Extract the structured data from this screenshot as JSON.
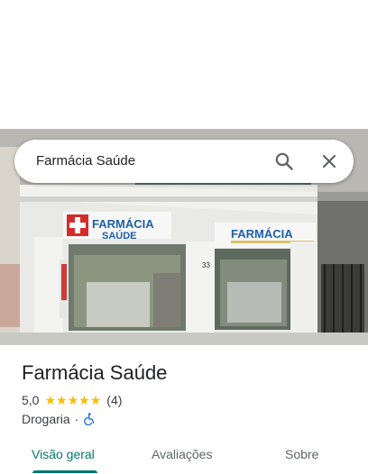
{
  "search": {
    "query": "Farmácia Saúde",
    "search_icon": "search-icon",
    "close_icon": "close-icon"
  },
  "photo": {
    "sign_left_line1": "FARMÁCIA",
    "sign_left_line2": "SAÚDE",
    "sign_right": "FARMÁCIA",
    "street_number": "33"
  },
  "place": {
    "name": "Farmácia Saúde",
    "rating": "5,0",
    "stars": 5,
    "review_count": "(4)",
    "category": "Drogaria",
    "separator": "·",
    "accessibility_icon": "wheelchair-icon"
  },
  "tabs": [
    {
      "label": "Visão geral",
      "active": true
    },
    {
      "label": "Avaliações",
      "active": false
    },
    {
      "label": "Sobre",
      "active": false
    }
  ],
  "colors": {
    "accent": "#00796b",
    "star": "#fbbc04",
    "pharmacy_blue": "#1d5fa8",
    "cross_red": "#d62b2b"
  }
}
